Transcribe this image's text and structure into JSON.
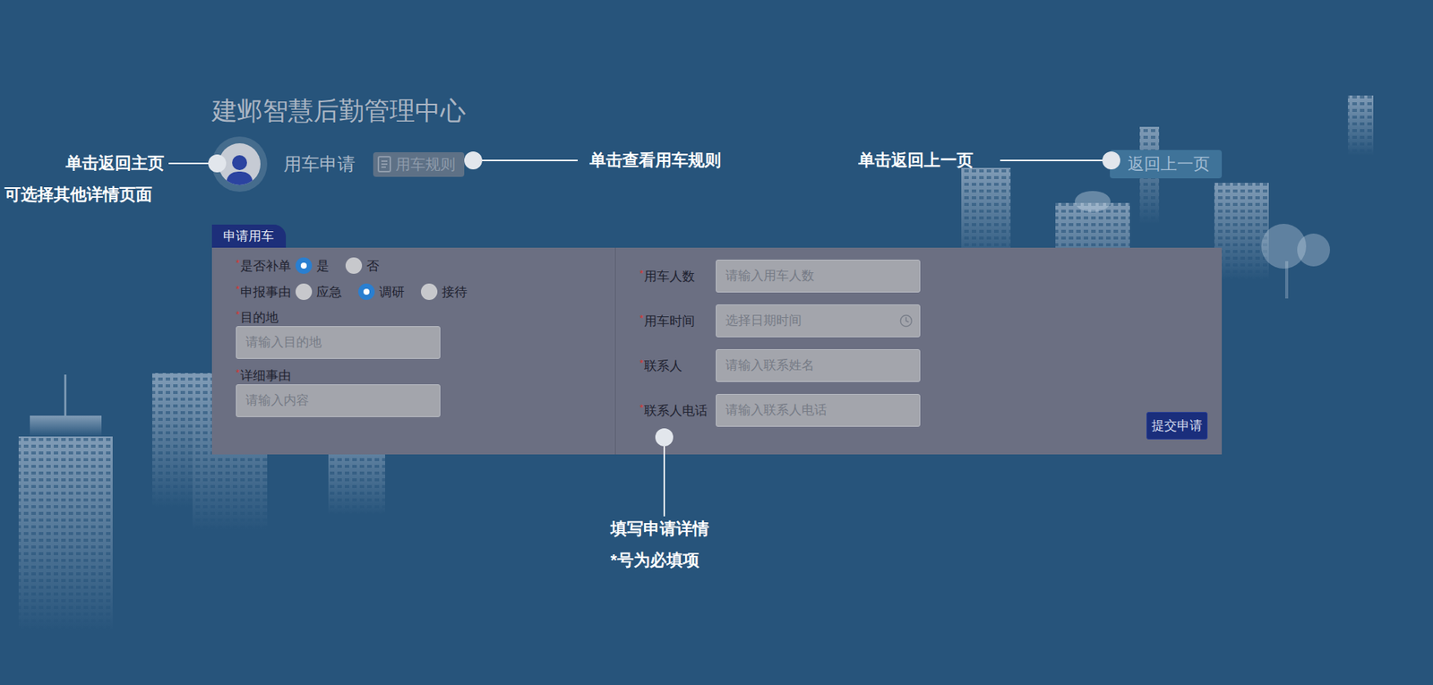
{
  "title": "建邺智慧后勤管理中心",
  "header": {
    "page_title": "用车申请",
    "rules_button": "用车规则",
    "back_button": "返回上一页"
  },
  "form": {
    "tab": "申请用车",
    "required_mark": "*",
    "left_fields": [
      {
        "kind": "radio",
        "label": "是否补单",
        "required": true,
        "options": [
          {
            "label": "是",
            "selected": true
          },
          {
            "label": "否",
            "selected": false
          }
        ]
      },
      {
        "kind": "radio",
        "label": "申报事由",
        "required": true,
        "options": [
          {
            "label": "应急",
            "selected": false
          },
          {
            "label": "调研",
            "selected": true
          },
          {
            "label": "接待",
            "selected": false
          }
        ]
      },
      {
        "kind": "input",
        "label": "目的地",
        "required": true,
        "placeholder": "请输入目的地"
      },
      {
        "kind": "input",
        "label": "详细事由",
        "required": true,
        "placeholder": "请输入内容"
      }
    ],
    "right_fields": [
      {
        "kind": "text",
        "label": "用车人数",
        "required": true,
        "placeholder": "请输入用车人数"
      },
      {
        "kind": "datetime",
        "label": "用车时间",
        "required": true,
        "placeholder": "选择日期时间"
      },
      {
        "kind": "text",
        "label": "联系人",
        "required": true,
        "placeholder": "请输入联系姓名"
      },
      {
        "kind": "text",
        "label": "联系人电话",
        "required": true,
        "placeholder": "请输入联系人电话"
      }
    ],
    "submit": "提交申请"
  },
  "annotations": [
    {
      "lines": [
        "单击返回主页",
        "可选择其他详情页面"
      ]
    },
    {
      "lines": [
        "单击查看用车规则"
      ]
    },
    {
      "lines": [
        "单击返回上一页"
      ]
    },
    {
      "lines": [
        "填写申请详情",
        "*号为必填项"
      ]
    }
  ]
}
